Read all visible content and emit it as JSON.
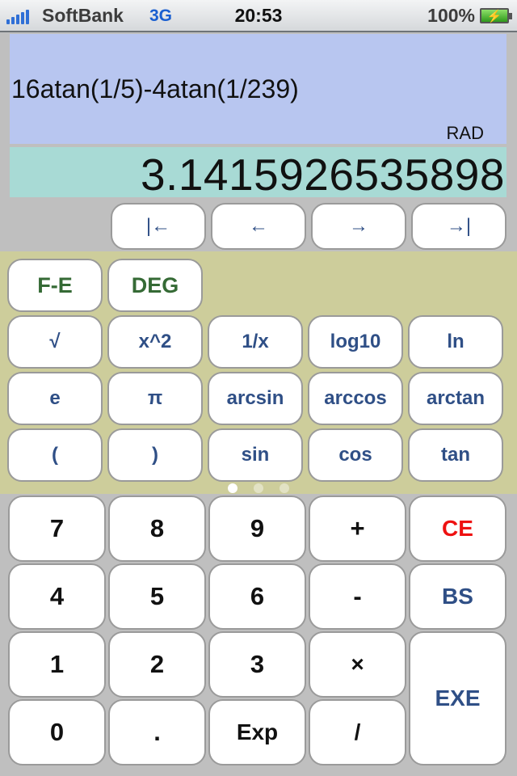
{
  "status_bar": {
    "carrier": "SoftBank",
    "network": "3G",
    "time": "20:53",
    "battery_percent": "100%",
    "battery_icon": "battery-charging-icon",
    "signal_icon": "signal-bars-icon"
  },
  "display": {
    "expression": "16atan(1/5)-4atan(1/239)",
    "angle_mode": "RAD",
    "result": "3.1415926535898",
    "colors": {
      "expression_bg": "#b8c6f0",
      "result_bg": "#a8dad5"
    }
  },
  "cursor_keys": [
    {
      "label": "|←",
      "action": "cursor-home"
    },
    {
      "label": "←",
      "action": "cursor-left"
    },
    {
      "label": "→",
      "action": "cursor-right"
    },
    {
      "label": "→|",
      "action": "cursor-end"
    }
  ],
  "function_keys": {
    "mode_row": [
      "F-E",
      "DEG"
    ],
    "rows": [
      [
        "√",
        "x^2",
        "1/x",
        "log10",
        "ln"
      ],
      [
        "e",
        "π",
        "arcsin",
        "arccos",
        "arctan"
      ],
      [
        "(",
        ")",
        "sin",
        "cos",
        "tan"
      ]
    ],
    "page_indicator": {
      "current": 1,
      "total": 3
    },
    "colors": {
      "panel_bg": "#cdcd9b",
      "mode_text": "#356a35",
      "func_text": "#2f4f86"
    }
  },
  "number_keys": {
    "rows": [
      [
        "7",
        "8",
        "9",
        "+",
        "CE"
      ],
      [
        "4",
        "5",
        "6",
        "-",
        "BS"
      ],
      [
        "1",
        "2",
        "3",
        "×"
      ],
      [
        "0",
        ".",
        "Exp",
        "/"
      ]
    ],
    "exe_label": "EXE",
    "colors": {
      "ce_text": "#ee1111",
      "bs_exe_text": "#2f4f86",
      "digit_text": "#111111"
    }
  }
}
